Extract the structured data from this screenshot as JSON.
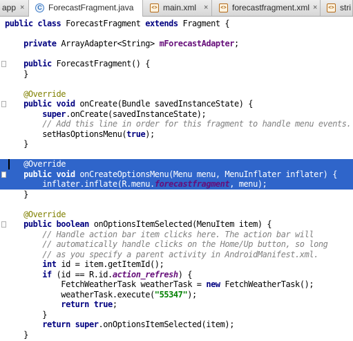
{
  "tabs": [
    {
      "label": "app",
      "icon": "module-icon",
      "close": "×",
      "active": false
    },
    {
      "label": "ForecastFragment.java",
      "icon": "class-icon",
      "close": "×",
      "active": true
    },
    {
      "label": "main.xml",
      "icon": "xml-file-icon",
      "close": "×",
      "active": false
    },
    {
      "label": "forecastfragment.xml",
      "icon": "xml-file-icon",
      "close": "×",
      "active": false
    },
    {
      "label": "stri",
      "icon": "xml-file-icon",
      "close": "",
      "active": false
    }
  ],
  "code_lines": [
    {
      "selected": false,
      "tokens": [
        [
          "kw",
          "public class "
        ],
        [
          "",
          "ForecastFragment "
        ],
        [
          "kw",
          "extends "
        ],
        [
          "",
          "Fragment {"
        ]
      ]
    },
    {
      "selected": false,
      "tokens": []
    },
    {
      "selected": false,
      "tokens": [
        [
          "",
          "    "
        ],
        [
          "kw",
          "private "
        ],
        [
          "",
          "ArrayAdapter<String> "
        ],
        [
          "fld",
          "mForecastAdapter"
        ],
        [
          "",
          ";"
        ]
      ]
    },
    {
      "selected": false,
      "tokens": []
    },
    {
      "selected": false,
      "tokens": [
        [
          "",
          "    "
        ],
        [
          "kw",
          "public "
        ],
        [
          "",
          "ForecastFragment() {"
        ]
      ]
    },
    {
      "selected": false,
      "tokens": [
        [
          "",
          "    }"
        ]
      ]
    },
    {
      "selected": false,
      "tokens": []
    },
    {
      "selected": false,
      "tokens": [
        [
          "",
          "    "
        ],
        [
          "ann",
          "@Override"
        ]
      ]
    },
    {
      "selected": false,
      "tokens": [
        [
          "",
          "    "
        ],
        [
          "kw",
          "public void "
        ],
        [
          "",
          "onCreate(Bundle savedInstanceState) {"
        ]
      ]
    },
    {
      "selected": false,
      "tokens": [
        [
          "",
          "        "
        ],
        [
          "kw",
          "super"
        ],
        [
          "",
          ".onCreate(savedInstanceState);"
        ]
      ]
    },
    {
      "selected": false,
      "tokens": [
        [
          "",
          "        "
        ],
        [
          "cmt",
          "// Add this line in order for this fragment to handle menu events."
        ]
      ]
    },
    {
      "selected": false,
      "tokens": [
        [
          "",
          "        setHasOptionsMenu("
        ],
        [
          "kw",
          "true"
        ],
        [
          "",
          ");"
        ]
      ]
    },
    {
      "selected": false,
      "tokens": [
        [
          "",
          "    }"
        ]
      ]
    },
    {
      "selected": false,
      "tokens": []
    },
    {
      "selected": true,
      "tokens": [
        [
          "",
          "    "
        ],
        [
          "ann",
          "@Override"
        ]
      ]
    },
    {
      "selected": true,
      "tokens": [
        [
          "",
          "    "
        ],
        [
          "kw",
          "public void "
        ],
        [
          "",
          "onCreateOptionsMenu(Menu menu, MenuInflater inflater) {"
        ]
      ]
    },
    {
      "selected": true,
      "tokens": [
        [
          "",
          "        inflater.inflate(R.menu."
        ],
        [
          "fldi",
          "forecastfragment"
        ],
        [
          "",
          ", menu);"
        ]
      ]
    },
    {
      "selected": false,
      "tokens": [
        [
          "",
          "    }"
        ]
      ]
    },
    {
      "selected": false,
      "tokens": []
    },
    {
      "selected": false,
      "tokens": [
        [
          "",
          "    "
        ],
        [
          "ann",
          "@Override"
        ]
      ]
    },
    {
      "selected": false,
      "tokens": [
        [
          "",
          "    "
        ],
        [
          "kw",
          "public boolean "
        ],
        [
          "",
          "onOptionsItemSelected(MenuItem item) {"
        ]
      ]
    },
    {
      "selected": false,
      "tokens": [
        [
          "",
          "        "
        ],
        [
          "cmt",
          "// Handle action bar item clicks here. The action bar will"
        ]
      ]
    },
    {
      "selected": false,
      "tokens": [
        [
          "",
          "        "
        ],
        [
          "cmt",
          "// automatically handle clicks on the Home/Up button, so long"
        ]
      ]
    },
    {
      "selected": false,
      "tokens": [
        [
          "",
          "        "
        ],
        [
          "cmt",
          "// as you specify a parent activity in AndroidManifest.xml."
        ]
      ]
    },
    {
      "selected": false,
      "tokens": [
        [
          "",
          "        "
        ],
        [
          "kw",
          "int "
        ],
        [
          "",
          "id = item.getItemId();"
        ]
      ]
    },
    {
      "selected": false,
      "tokens": [
        [
          "",
          "        "
        ],
        [
          "kw",
          "if "
        ],
        [
          "",
          "(id == R.id."
        ],
        [
          "fldi",
          "action_refresh"
        ],
        [
          "",
          ") {"
        ]
      ]
    },
    {
      "selected": false,
      "tokens": [
        [
          "",
          "            FetchWeatherTask weatherTask = "
        ],
        [
          "kw",
          "new "
        ],
        [
          "",
          "FetchWeatherTask();"
        ]
      ]
    },
    {
      "selected": false,
      "tokens": [
        [
          "",
          "            weatherTask.execute("
        ],
        [
          "str",
          "\"55347\""
        ],
        [
          "",
          ");"
        ]
      ]
    },
    {
      "selected": false,
      "tokens": [
        [
          "",
          "            "
        ],
        [
          "kw",
          "return true"
        ],
        [
          "",
          ";"
        ]
      ]
    },
    {
      "selected": false,
      "tokens": [
        [
          "",
          "        }"
        ]
      ]
    },
    {
      "selected": false,
      "tokens": [
        [
          "",
          "        "
        ],
        [
          "kw",
          "return super"
        ],
        [
          "",
          ".onOptionsItemSelected(item);"
        ]
      ]
    },
    {
      "selected": false,
      "tokens": [
        [
          "",
          "    }"
        ]
      ]
    }
  ]
}
